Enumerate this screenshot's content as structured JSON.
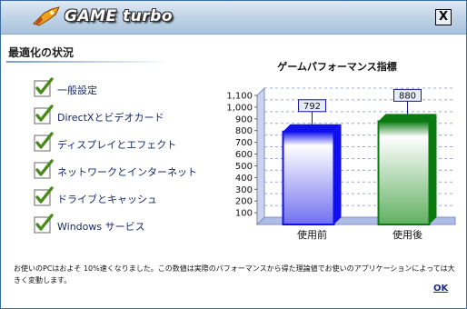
{
  "app": {
    "title": "GAME turbo"
  },
  "titlebar": {
    "close_label": "X"
  },
  "section": {
    "title": "最適化の状況"
  },
  "checklist": [
    {
      "label": "一般設定",
      "checked": true
    },
    {
      "label": "DirectXとビデオカード",
      "checked": true
    },
    {
      "label": "ディスプレイとエフェクト",
      "checked": true
    },
    {
      "label": "ネットワークとインターネット",
      "checked": true
    },
    {
      "label": "ドライブとキャッシュ",
      "checked": true
    },
    {
      "label": "Windows サービス",
      "checked": true
    }
  ],
  "chart_data": {
    "type": "bar",
    "title": "ゲームパフォーマンス指標",
    "categories": [
      "使用前",
      "使用後"
    ],
    "values": [
      792,
      880
    ],
    "data_labels": [
      "792",
      "880"
    ],
    "ylim": [
      0,
      1100
    ],
    "yticks": [
      100,
      200,
      300,
      400,
      500,
      600,
      700,
      800,
      900,
      "1,000",
      "1,100"
    ],
    "ytick_values": [
      100,
      200,
      300,
      400,
      500,
      600,
      700,
      800,
      900,
      1000,
      1100
    ],
    "grid": true,
    "colors": [
      "#1010ee",
      "#0a7a10"
    ]
  },
  "footer": {
    "message": "お使いのPCはおよそ 10%速くなりました。この数値は実際のパフォーマンスから得た理論値でお使いのアプリケーションによっては大きく変動します。",
    "ok_label": "OK"
  }
}
